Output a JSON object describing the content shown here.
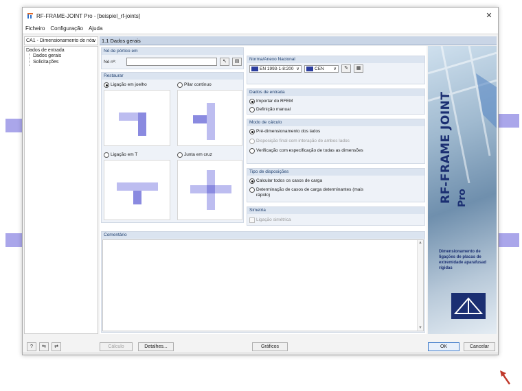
{
  "window": {
    "title": "RF-FRAME-JOINT Pro - [beispiel_rf-joints]"
  },
  "menu": [
    "Ficheiro",
    "Configuração",
    "Ajuda"
  ],
  "case_selector": {
    "value": "CA1 - Dimensionamento de nós"
  },
  "nav": {
    "root": "Dados de entrada",
    "items": [
      "Dados gerais",
      "Solicitações"
    ]
  },
  "page_header": "1.1 Dados gerais",
  "node_group": {
    "title": "Nó de pórtico em",
    "label": "Nó nº:",
    "value": ""
  },
  "restore_group": {
    "title": "Restaurar",
    "options": [
      {
        "label": "Ligação em joelho",
        "selected": true
      },
      {
        "label": "Pilar contínuo",
        "selected": false
      },
      {
        "label": "Ligação em T",
        "selected": false
      },
      {
        "label": "Junta em cruz",
        "selected": false
      }
    ]
  },
  "norm_group": {
    "title": "Norma/Anexo Nacional",
    "norm": "EN 1993-1-8:200",
    "annex": "CEN"
  },
  "input_group": {
    "title": "Dados de entrada",
    "options": [
      {
        "label": "Importar do RFEM",
        "selected": true
      },
      {
        "label": "Definição manual",
        "selected": false
      }
    ]
  },
  "calc_group": {
    "title": "Modo de cálculo",
    "options": [
      {
        "label": "Pré-dimensionamento dos lados",
        "selected": true,
        "disabled": false
      },
      {
        "label": "Disposição final com interação de ambos lados",
        "selected": false,
        "disabled": true
      },
      {
        "label": "Verificação com especificação de todas as dimensões",
        "selected": false,
        "disabled": false
      }
    ]
  },
  "layout_group": {
    "title": "Tipo de disposições",
    "options": [
      {
        "label": "Calcular todos os casos de carga",
        "selected": true
      },
      {
        "label_line1": "Determinação de casos de carga determinantes (mais",
        "label_line2": "rápido)",
        "selected": false
      }
    ]
  },
  "sym_group": {
    "title": "Simetria",
    "label": "Ligação simétrica",
    "checked": false
  },
  "comment": {
    "title": "Comentário",
    "value": ""
  },
  "brand": {
    "title": "RF-FRAME JOINT",
    "pro": "Pro",
    "desc": "Dimensionamento de ligações de placas de extremidade aparafusad rígidas"
  },
  "buttons": {
    "calc": "Cálculo",
    "details": "Detalhes...",
    "graphics": "Gráficos",
    "ok": "OK",
    "cancel": "Cancelar"
  }
}
